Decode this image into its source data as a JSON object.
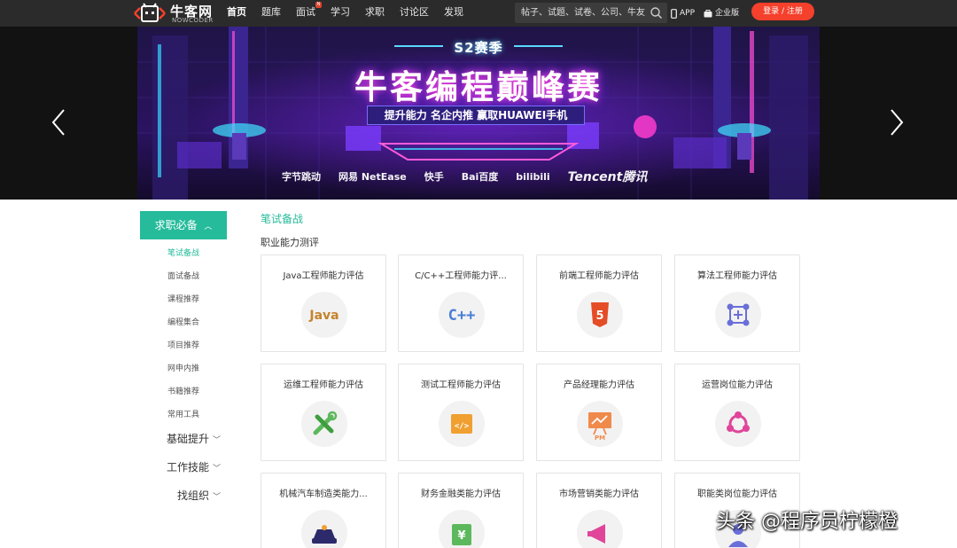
{
  "header": {
    "logo_title": "牛客网",
    "logo_sub": "NOWCODER",
    "nav": [
      {
        "label": "首页",
        "active": true
      },
      {
        "label": "题库"
      },
      {
        "label": "面试",
        "badge": "N"
      },
      {
        "label": "学习"
      },
      {
        "label": "求职"
      },
      {
        "label": "讨论区"
      },
      {
        "label": "发现"
      }
    ],
    "search_placeholder": "帖子、试题、试卷、公司、牛友",
    "app_label": "APP",
    "enterprise_label": "企业版",
    "login_label": "登录 / 注册"
  },
  "banner": {
    "season": "S2赛季",
    "title": "牛客编程巅峰赛",
    "tagline": "提升能力  名企内推  赢取HUAWEI手机",
    "sponsors": [
      "字节跳动",
      "网易 NetEase",
      "快手",
      "Bai百度",
      "bilibili",
      "Tencent腾讯"
    ]
  },
  "sidebar": {
    "head": "求职必备",
    "sub_items": [
      "笔试备战",
      "面试备战",
      "课程推荐",
      "编程集合",
      "项目推荐",
      "网申内推",
      "书籍推荐",
      "常用工具"
    ],
    "groups": [
      "基础提升",
      "工作技能",
      "找组织"
    ]
  },
  "main": {
    "section_title": "笔试备战",
    "section_sub": "职业能力测评",
    "cards": [
      {
        "title": "Java工程师能力评估",
        "icon": "java-icon",
        "icon_text": "Java"
      },
      {
        "title": "C/C++工程师能力评...",
        "icon": "cpp-icon",
        "icon_text": "C++"
      },
      {
        "title": "前端工程师能力评估",
        "icon": "html5-icon",
        "icon_text": "5"
      },
      {
        "title": "算法工程师能力评估",
        "icon": "algorithm-icon"
      },
      {
        "title": "运维工程师能力评估",
        "icon": "tools-icon"
      },
      {
        "title": "测试工程师能力评估",
        "icon": "code-icon",
        "icon_text": "</>"
      },
      {
        "title": "产品经理能力评估",
        "icon": "pm-board-icon",
        "icon_text": "PM"
      },
      {
        "title": "运营岗位能力评估",
        "icon": "share-nodes-icon"
      },
      {
        "title": "机械汽车制造类能力...",
        "icon": "vehicle-icon"
      },
      {
        "title": "财务金融类能力评估",
        "icon": "yen-icon",
        "icon_text": "¥"
      },
      {
        "title": "市场营销类能力评估",
        "icon": "megaphone-icon"
      },
      {
        "title": "职能类岗位能力评估",
        "icon": "person-icon"
      }
    ]
  },
  "watermark": "头条 @程序员柠檬橙",
  "colors": {
    "accent": "#25bb9b",
    "login": "#f5402c",
    "topbar": "#2b2b2b"
  }
}
